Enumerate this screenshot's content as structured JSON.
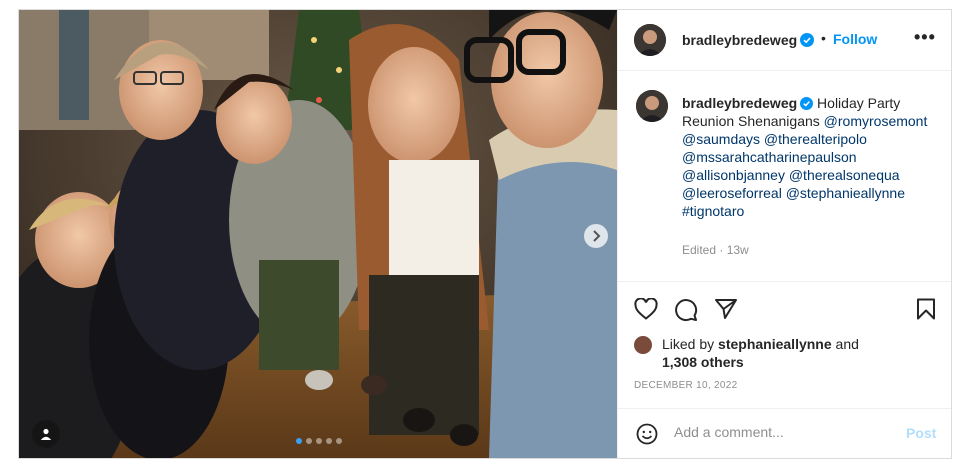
{
  "post": {
    "carousel": {
      "slide_count": 5,
      "active_index": 0
    }
  },
  "header": {
    "username": "bradleybredeweg",
    "separator": "•",
    "follow_label": "Follow",
    "more_label": "•••"
  },
  "caption": {
    "username": "bradleybredeweg",
    "text": "Holiday Party Reunion Shenanigans",
    "mentions": [
      "@romyrosemont",
      "@saumdays",
      "@therealteripolo",
      "@mssarahcatharinepaulson",
      "@allisonbjanney",
      "@therealsonequa",
      "@leeroseforreal",
      "@stephanieallynne",
      "#tignotaro"
    ],
    "edited": "Edited · 13w"
  },
  "likes": {
    "prefix": "Liked by",
    "liker": "stephanieallynne",
    "joiner": "and",
    "others": "1,308 others"
  },
  "date": "DECEMBER 10, 2022",
  "comment": {
    "placeholder": "Add a comment...",
    "post_label": "Post"
  },
  "colors": {
    "accent": "#0095f6",
    "verified": "#0095f6",
    "mention": "#00376b",
    "muted": "#8e8e8e",
    "post_disabled": "#b2dffc"
  }
}
